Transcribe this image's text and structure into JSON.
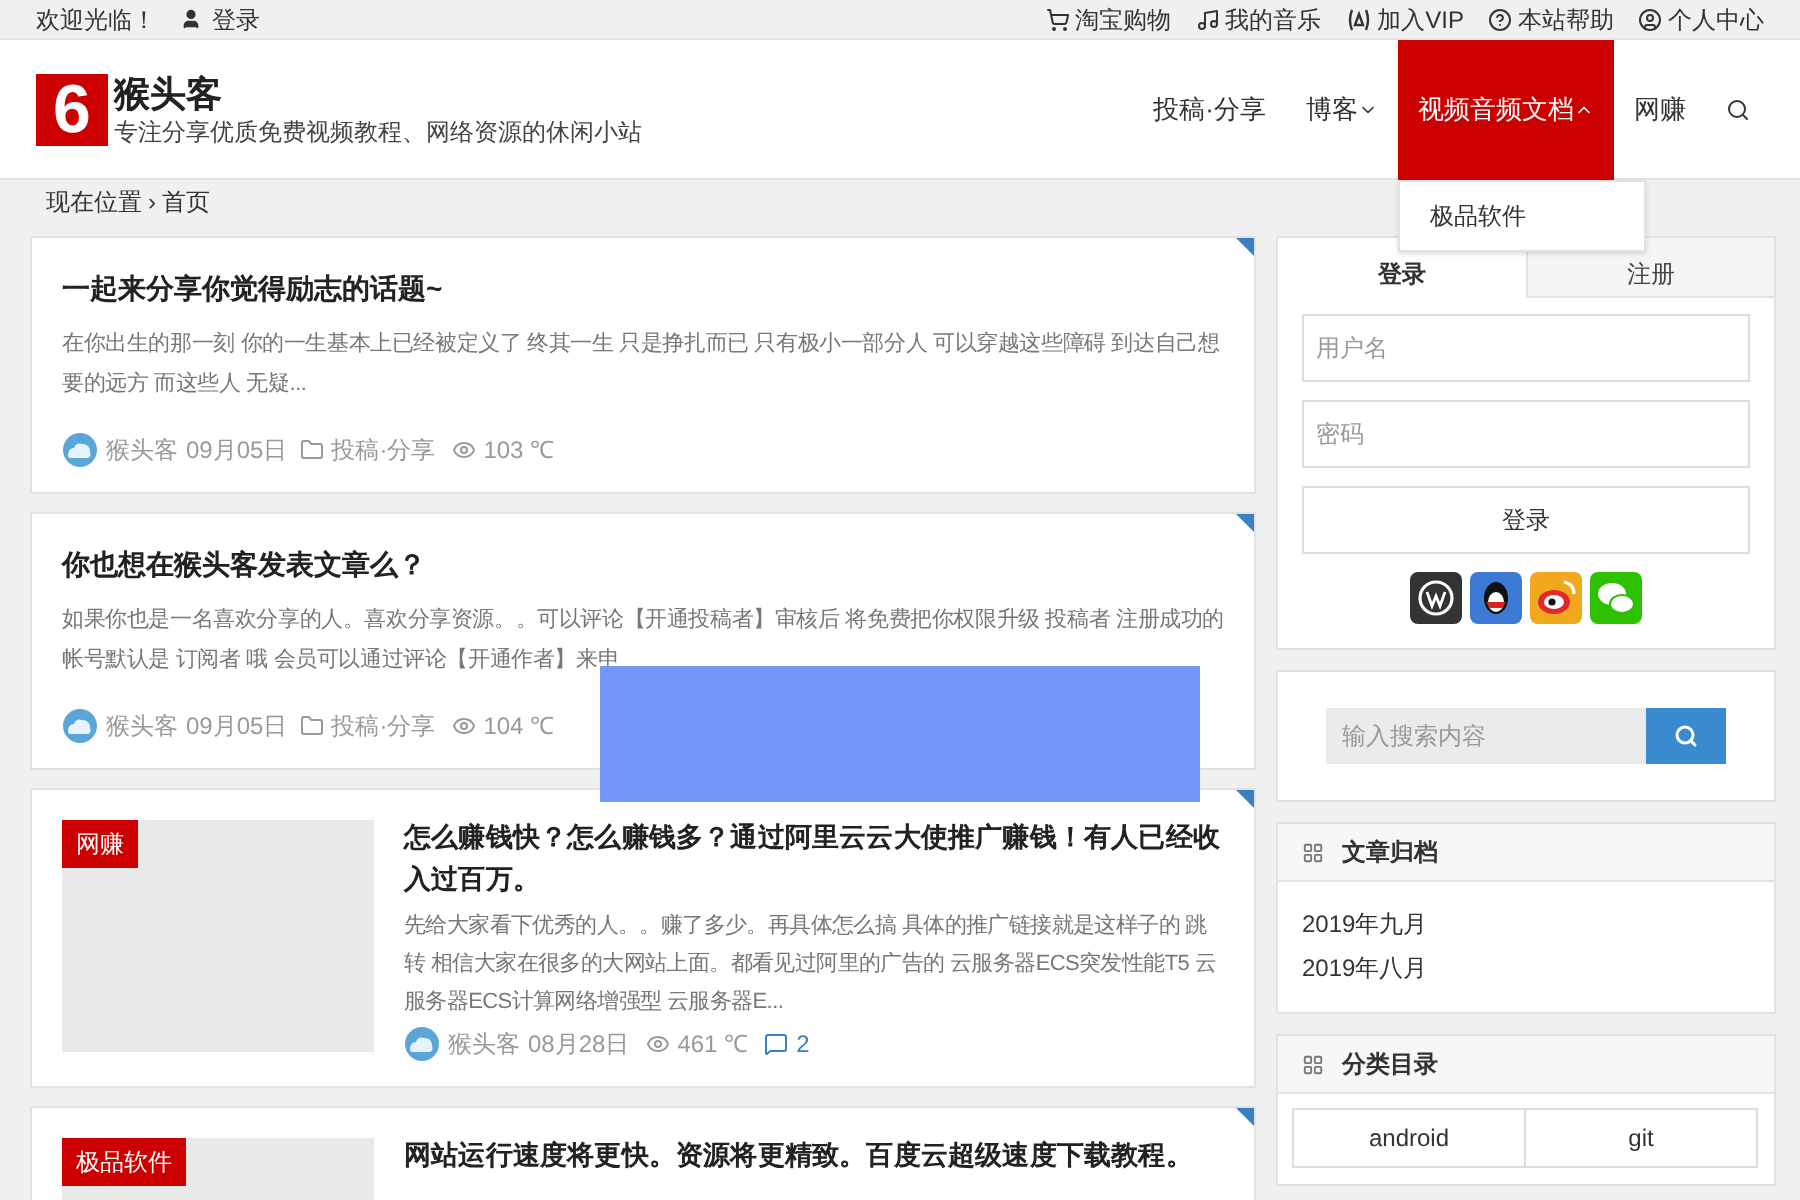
{
  "top_bar": {
    "welcome": "欢迎光临！",
    "login": "登录",
    "links": [
      "淘宝购物",
      "我的音乐",
      "加入VIP",
      "本站帮助",
      "个人中心"
    ]
  },
  "header": {
    "logo_mark": "6",
    "site_name": "猴头客",
    "tagline": "专注分享优质免费视频教程、网络资源的休闲小站"
  },
  "nav": {
    "items": [
      {
        "label": "投稿·分享",
        "kind": "link",
        "selected": false
      },
      {
        "label": "博客",
        "kind": "dropdown",
        "selected": false,
        "expanded": false
      },
      {
        "label": "视频音频文档",
        "kind": "dropdown",
        "selected": true,
        "expanded": true
      },
      {
        "label": "网赚",
        "kind": "link",
        "selected": false
      }
    ],
    "submenu": [
      "极品软件"
    ]
  },
  "breadcrumb": {
    "label": "现在位置",
    "separator": "›",
    "current": "首页"
  },
  "posts": [
    {
      "kind": "text",
      "title": "一起来分享你觉得励志的话题~",
      "excerpt": "在你出生的那一刻 你的一生基本上已经被定义了 终其一生 只是挣扎而已 只有极小一部分人 可以穿越这些障碍 到达自己想要的远方 而这些人 无疑...",
      "author": "猴头客",
      "date": "09月05日",
      "category": "投稿·分享",
      "views": "103 ℃"
    },
    {
      "kind": "text",
      "title": "你也想在猴头客发表文章么？",
      "excerpt": "如果你也是一名喜欢分享的人。喜欢分享资源。。可以评论【开通投稿者】审核后 将免费把你权限升级 投稿者 注册成功的帐号默认是 订阅者 哦 会员可以通过评论【开通作者】来申",
      "author": "猴头客",
      "date": "09月05日",
      "category": "投稿·分享",
      "views": "104 ℃"
    },
    {
      "kind": "thumbnail",
      "tag": "网赚",
      "title": "怎么赚钱快？怎么赚钱多？通过阿里云云大使推广赚钱！有人已经收入过百万。",
      "excerpt": "先给大家看下优秀的人。。赚了多少。再具体怎么搞 具体的推广链接就是这样子的 跳转 相信大家在很多的大网站上面。都看见过阿里的广告的 云服务器ECS突发性能T5 云服务器ECS计算网络增强型 云服务器E...",
      "author": "猴头客",
      "date": "08月28日",
      "views": "461 ℃",
      "comments": "2"
    },
    {
      "kind": "thumbnail",
      "tag": "极品软件",
      "title": "网站运行速度将更快。资源将更精致。百度云超级速度下载教程。"
    }
  ],
  "login": {
    "tabs": [
      {
        "label": "登录",
        "selected": true
      },
      {
        "label": "注册",
        "selected": false
      }
    ],
    "username_placeholder": "用户名",
    "password_placeholder": "密码",
    "button": "登录"
  },
  "search": {
    "placeholder": "输入搜索内容"
  },
  "archives": {
    "title": "文章归档",
    "items": [
      "2019年九月",
      "2019年八月"
    ]
  },
  "categories": {
    "title": "分类目录",
    "items": [
      "android",
      "git"
    ]
  }
}
